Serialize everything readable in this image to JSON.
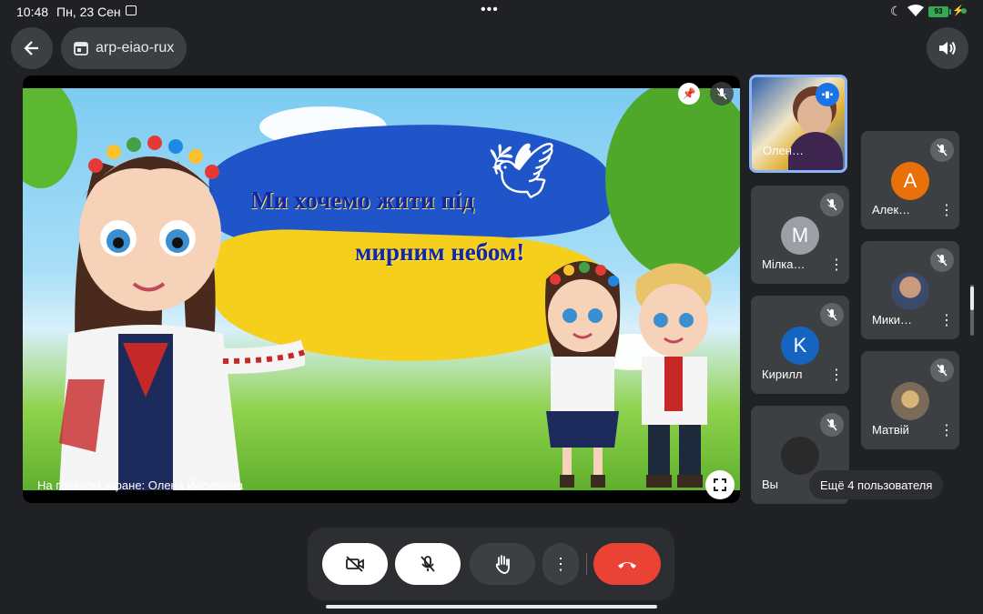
{
  "status_bar": {
    "time": "10:48",
    "date": "Пн, 23 Сен",
    "battery": "93",
    "icons": [
      "cast-icon",
      "moon-icon",
      "wifi-icon",
      "battery-icon",
      "charging-icon"
    ]
  },
  "header": {
    "meeting_code": "arp-eiao-rux",
    "back_icon": "arrow-left-icon",
    "sound_icon": "speaker-icon"
  },
  "presentation": {
    "slide_line1": "Ми хочемо жити під",
    "slide_line2": "мирним небом!",
    "caption": "На главном экране: Олена Йосипівна"
  },
  "participants": [
    {
      "name": "Олен…",
      "type": "photo",
      "speaking": true
    },
    {
      "name": "Мілка…",
      "initial": "M",
      "color": "#9aa0a6"
    },
    {
      "name": "Кирилл",
      "initial": "K",
      "color": "#1565c0"
    },
    {
      "name": "Вы",
      "type": "photo"
    },
    {
      "name": "Алек…",
      "initial": "A",
      "color": "#e8710a"
    },
    {
      "name": "Мики…",
      "type": "photo"
    },
    {
      "name": "Матвій",
      "type": "photo"
    }
  ],
  "more_users": "Ещё 4 пользователя",
  "controls": {
    "camera": "camera-off-icon",
    "mic": "mic-off-icon",
    "hand": "raise-hand-icon",
    "more": "more-vert-icon",
    "end": "end-call-icon"
  },
  "colors": {
    "background": "#202124",
    "surface": "#3c4043",
    "end_call": "#ea4335",
    "accent": "#8ab4f8"
  }
}
